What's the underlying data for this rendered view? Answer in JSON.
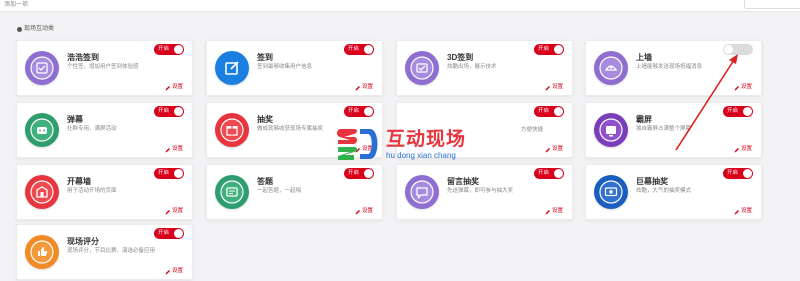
{
  "header": {
    "title": "添加一项"
  },
  "section": {
    "title": "现场互动类"
  },
  "cards": [
    {
      "name": "浩浩签到",
      "desc": "个性签，增加用户签到体验感",
      "toggle": "开启",
      "on": true,
      "settings": "设置",
      "icon": "signin-icon",
      "color": "#8e6fcf"
    },
    {
      "name": "签到",
      "desc": "签到最够收集用户信息",
      "toggle": "开启",
      "on": true,
      "settings": "设置",
      "icon": "edit-checkin-icon",
      "color": "#1a7fe0"
    },
    {
      "name": "3D签到",
      "desc": "炫酷出场，展示技术",
      "toggle": "开启",
      "on": true,
      "settings": "设置",
      "icon": "3d-signin-icon",
      "color": "#8e6fcf"
    },
    {
      "name": "上墙",
      "desc": "上墙能够发送现场祝福消息",
      "toggle": "",
      "on": false,
      "settings": "设置",
      "icon": "wall-icon",
      "color": "#8e6fcf"
    },
    {
      "name": "弹幕",
      "desc": "社群专用，满屏活动",
      "toggle": "开启",
      "on": true,
      "settings": "设置",
      "icon": "danmaku-icon",
      "color": "#2f9e6e"
    },
    {
      "name": "抽奖",
      "desc": "做成就够收获现场专属抽奖",
      "toggle": "开启",
      "on": true,
      "settings": "设置",
      "icon": "lottery-icon",
      "color": "#e8343c"
    },
    {
      "name": "",
      "desc": "方便快捷",
      "toggle": "开启",
      "on": true,
      "settings": "设置",
      "icon": "",
      "color": ""
    },
    {
      "name": "霸屏",
      "desc": "独自霸屏占满整个屏幕",
      "toggle": "开启",
      "on": true,
      "settings": "设置",
      "icon": "takeover-icon",
      "color": "#7a3fb8"
    },
    {
      "name": "开幕墙",
      "desc": "用于活动开场的页面",
      "toggle": "开启",
      "on": true,
      "settings": "设置",
      "icon": "opening-wall-icon",
      "color": "#e8343c"
    },
    {
      "name": "答题",
      "desc": "一起答题，一起嗨",
      "toggle": "开启",
      "on": true,
      "settings": "设置",
      "icon": "quiz-icon",
      "color": "#2f9e6e"
    },
    {
      "name": "留言抽奖",
      "desc": "先送弹幕，即可参与抽大奖",
      "toggle": "开启",
      "on": true,
      "settings": "设置",
      "icon": "message-lottery-icon",
      "color": "#8e6fcf"
    },
    {
      "name": "巨幕抽奖",
      "desc": "炫酷，大气的抽奖模式",
      "toggle": "开启",
      "on": true,
      "settings": "设置",
      "icon": "big-screen-lottery-icon",
      "color": "#1a5fc0"
    },
    {
      "name": "现场评分",
      "desc": "现场评分，节目比赛，演选必备应用",
      "toggle": "开启",
      "on": true,
      "settings": "设置",
      "icon": "rating-icon",
      "color": "#f08a24"
    }
  ],
  "watermark": {
    "cn": "互动现场",
    "en": "hu dong xian chang"
  }
}
